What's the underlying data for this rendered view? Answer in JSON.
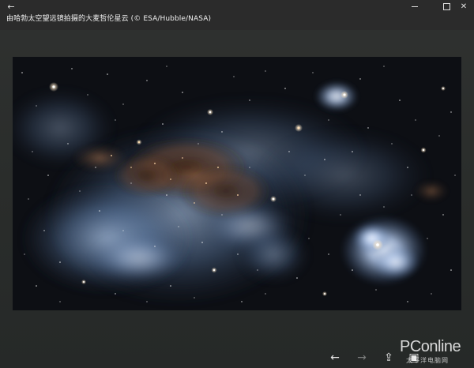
{
  "titlebar": {
    "back_glyph": "←",
    "title": "由哈勃太空望远镜拍摄的大麦哲伦星云 (© ESA/Hubble/NASA)",
    "minimize_icon": "minimize-icon",
    "maximize_icon": "maximize-icon",
    "close_glyph": "✕"
  },
  "photo": {
    "subject": "Large Magellanic Cloud nebula photo",
    "colors": {
      "space": "#0c0d10",
      "gas_blue": "#6f8fb8",
      "gas_light": "#c9d8ee",
      "dust_brown": "#5a3a24",
      "star": "#ffffff"
    }
  },
  "bottombar": {
    "prev_glyph": "←",
    "next_glyph": "→",
    "share_glyph": "⇪",
    "slideshow_glyph": "▣"
  },
  "watermark": {
    "logo": "PConline",
    "subtitle": "太平洋电脑网"
  }
}
